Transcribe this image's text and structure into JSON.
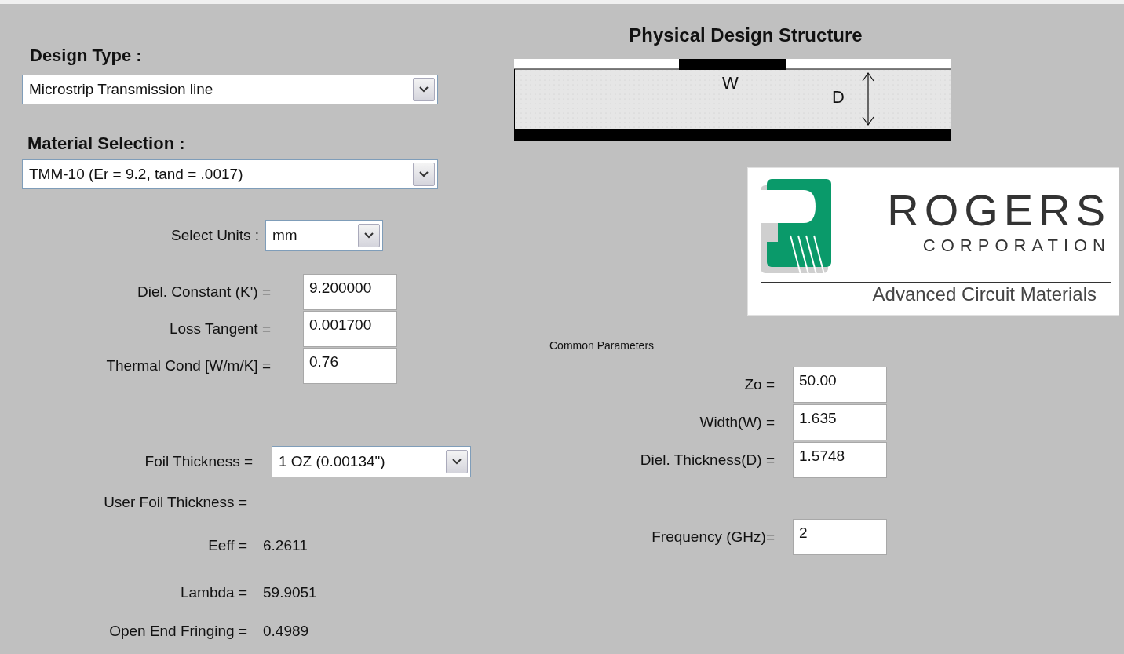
{
  "design_type": {
    "label": "Design Type :",
    "value": "Microstrip Transmission line"
  },
  "material_selection": {
    "label": "Material Selection :",
    "value": "TMM-10 (Er = 9.2, tand = .0017)"
  },
  "units": {
    "label": "Select Units :",
    "value": "mm"
  },
  "material_properties": [
    {
      "label": "Diel. Constant (K') =",
      "value": "9.200000"
    },
    {
      "label": "Loss Tangent =",
      "value": "0.001700"
    },
    {
      "label": "Thermal Cond [W/m/K]  =",
      "value": "0.76"
    }
  ],
  "foil_thickness": {
    "label": "Foil Thickness =",
    "value": "1 OZ (0.00134\")"
  },
  "user_foil_thickness": {
    "label": "User Foil Thickness ="
  },
  "results": [
    {
      "label": "Eeff =",
      "value": "6.2611"
    },
    {
      "label": "Lambda =",
      "value": "59.9051"
    },
    {
      "label": "Open End Fringing =",
      "value": "0.4989"
    }
  ],
  "structure": {
    "title": "Physical Design Structure",
    "width_label": "W",
    "depth_label": "D"
  },
  "logo": {
    "name": "ROGERS",
    "subtitle": "CORPORATION",
    "tagline": "Advanced Circuit Materials"
  },
  "common_parameters": {
    "title": "Common Parameters",
    "fields": [
      {
        "label": "Zo =",
        "value": "50.00"
      },
      {
        "label": "Width(W) =",
        "value": "1.635"
      },
      {
        "label": "Diel. Thickness(D) =",
        "value": "1.5748"
      }
    ]
  },
  "frequency": {
    "label": "Frequency (GHz)=",
    "value": "2"
  }
}
